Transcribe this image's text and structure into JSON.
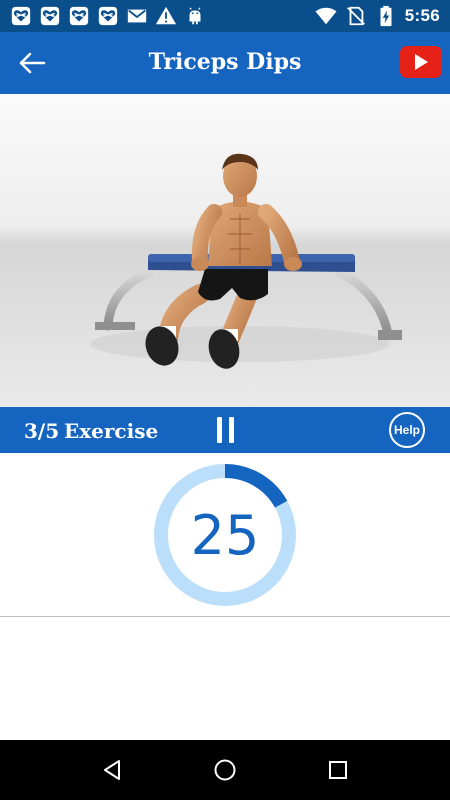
{
  "status_bar": {
    "time": "5:56",
    "left_icons": [
      "app-heart-icon",
      "app-heart-icon",
      "app-heart-icon",
      "app-heart-icon",
      "gmail-icon",
      "warning-icon",
      "android-debug-icon"
    ],
    "right_icons": [
      "wifi-icon",
      "no-sim-icon",
      "battery-charging-icon"
    ]
  },
  "app_bar": {
    "title": "Triceps Dips",
    "back_icon": "arrow-left-icon",
    "video_icon": "youtube-icon"
  },
  "exercise": {
    "progress": "3/5",
    "label": "Exercise",
    "help_label": "Help",
    "pause_icon": "pause-icon"
  },
  "timer": {
    "value": "25",
    "elapsed_fraction": 0.17,
    "track_color": "#bbdefb",
    "progress_color": "#1565c0"
  },
  "nav_bar": {
    "icons": [
      "back-triangle-icon",
      "home-circle-icon",
      "recents-square-icon"
    ]
  },
  "colors": {
    "status_bar": "#0a4f8c",
    "app_bar": "#1565c0",
    "accent": "#1565c0",
    "youtube": "#e62117"
  }
}
